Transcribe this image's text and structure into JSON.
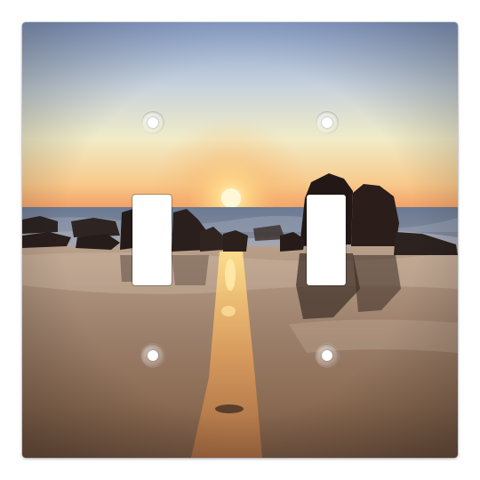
{
  "image": {
    "subject": "double-toggle-light-switch-plate",
    "scene": "sunset-over-ocean-with-rocks",
    "colors": {
      "sky_top": "#8fa6cf",
      "sky_mid": "#f2ead0",
      "horizon_glow": "#f6b06a",
      "sun": "#fff6c8",
      "sea": "#5b6f8f",
      "sand": "#9a7e62",
      "rocks": "#2a1f1d"
    }
  },
  "plate": {
    "switch_count": 2,
    "screw_count": 4
  }
}
